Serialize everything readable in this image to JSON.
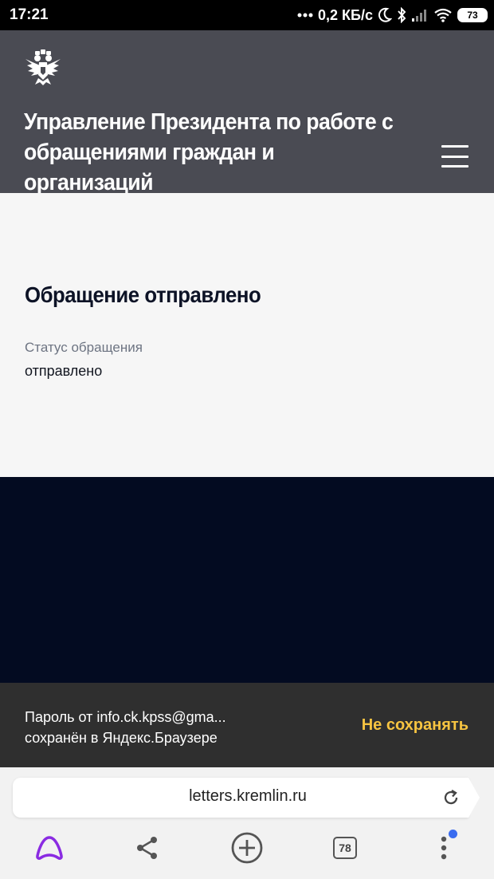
{
  "status_bar": {
    "time": "17:21",
    "network_speed": "0,2 КБ/с",
    "battery": "73",
    "icons": [
      "dots-icon",
      "moon-icon",
      "bluetooth-icon",
      "signal-icon",
      "wifi-icon",
      "battery-icon"
    ]
  },
  "header": {
    "emblem": "double-headed-eagle-emblem",
    "title": "Управление Президента по работе с обращениями граждан и организаций",
    "menu_icon": "hamburger-menu-icon"
  },
  "main": {
    "heading": "Обращение отправлено",
    "status_label": "Статус обращения",
    "status_value": "отправлено"
  },
  "snackbar": {
    "message_line1": "Пароль от info.ck.kpss@gma...",
    "message_line2": "сохранён в Яндекс.Браузере",
    "action": "Не сохранять",
    "action_color": "#f7c441"
  },
  "browser": {
    "url": "letters.kremlin.ru",
    "tabs_count": "78",
    "nav_icons": [
      "alice-icon",
      "share-icon",
      "new-tab-plus-icon",
      "tabs-icon",
      "more-menu-icon"
    ],
    "alice_color": "#8a2be2"
  },
  "colors": {
    "header_bg": "#4a4b53",
    "content_bg": "#f6f6f6",
    "footer_bg": "#030b21"
  }
}
